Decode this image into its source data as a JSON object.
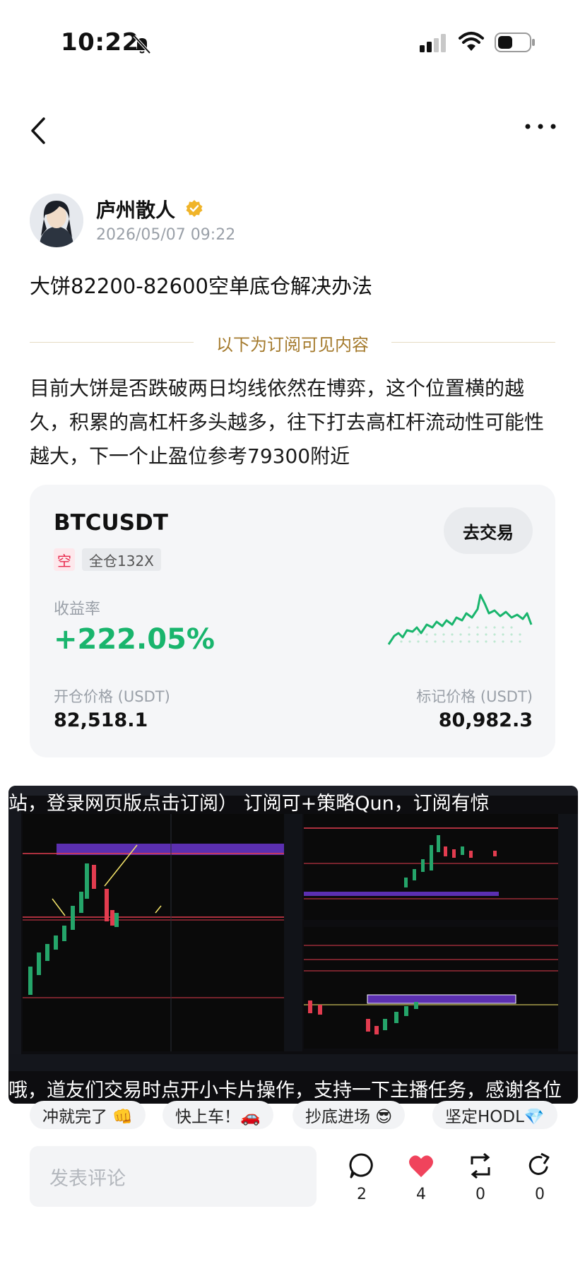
{
  "status_bar": {
    "time": "10:22"
  },
  "author": {
    "name": "庐州散人",
    "time": "2026/05/07 09:22"
  },
  "post": {
    "title": "大饼82200-82600空单底仓解决办法",
    "divider_text": "以下为订阅可见内容",
    "body": "目前大饼是否跌破两日均线依然在博弈，这个位置横的越久，积累的高杠杆多头越多，往下打去高杠杆流动性可能性越大，下一个止盈位参考79300附近"
  },
  "trade_card": {
    "symbol": "BTCUSDT",
    "action_label": "去交易",
    "direction_tag": "空",
    "leverage_tag": "全仓132X",
    "roi_label": "收益率",
    "roi_value": "+222.05%",
    "open_price_label": "开仓价格 (USDT)",
    "open_price": "82,518.1",
    "mark_price_label": "标记价格 (USDT)",
    "mark_price": "80,982.3",
    "colors": {
      "profit": "#19b56d",
      "short_tag": "#e8294d"
    }
  },
  "chart_image": {
    "overlay_top": "站，登录网页版点击订阅）    订阅可+策略Qun，订阅有惊",
    "overlay_bottom": "哦，道友们交易时点开小卡片操作，支持一下主播任务，感谢各位"
  },
  "reactions": [
    {
      "label": "冲就完了 👊"
    },
    {
      "label": "快上车！🚗"
    },
    {
      "label": "抄底进场 😎"
    },
    {
      "label": "坚定HODL💎"
    }
  ],
  "bottom_bar": {
    "comment_placeholder": "发表评论",
    "comments": "2",
    "likes": "4",
    "reposts": "0",
    "shares": "0",
    "like_color": "#f0435c"
  }
}
